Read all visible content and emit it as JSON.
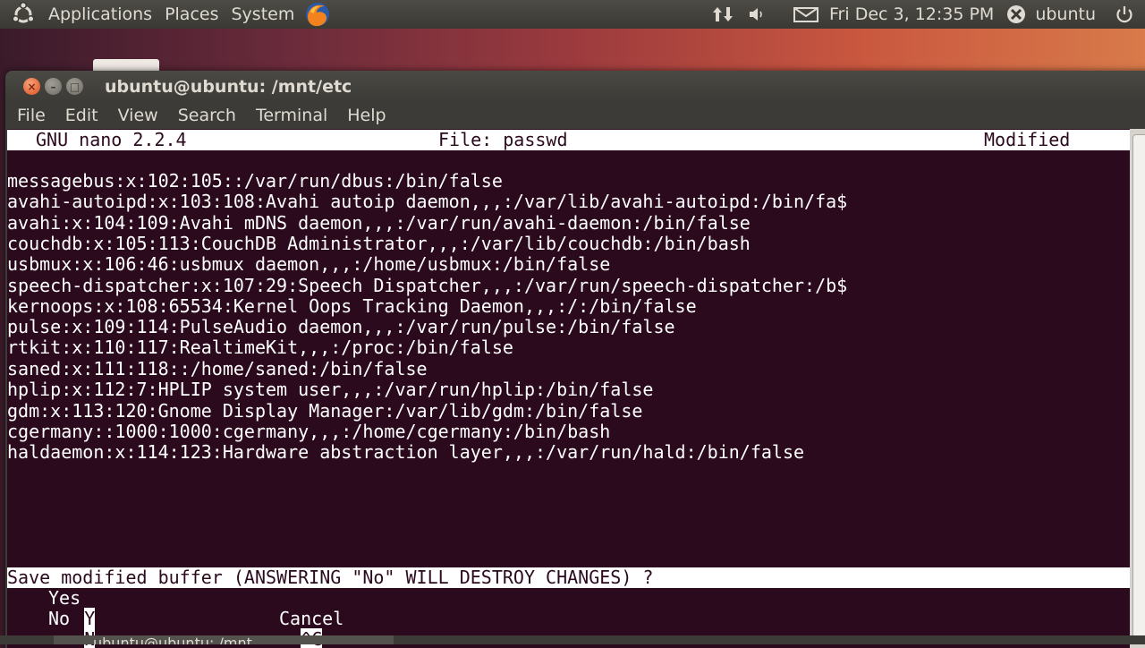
{
  "top_panel": {
    "applications": "Applications",
    "places": "Places",
    "system": "System",
    "clock": "Fri Dec 3, 12:35 PM",
    "user": "ubuntu"
  },
  "window": {
    "title": "ubuntu@ubuntu: /mnt/etc",
    "menu": [
      "File",
      "Edit",
      "View",
      "Search",
      "Terminal",
      "Help"
    ]
  },
  "nano": {
    "version": "GNU nano 2.2.4",
    "file": "File: passwd",
    "status": "Modified",
    "lines": [
      "messagebus:x:102:105::/var/run/dbus:/bin/false",
      "avahi-autoipd:x:103:108:Avahi autoip daemon,,,:/var/lib/avahi-autoipd:/bin/fa$",
      "avahi:x:104:109:Avahi mDNS daemon,,,:/var/run/avahi-daemon:/bin/false",
      "couchdb:x:105:113:CouchDB Administrator,,,:/var/lib/couchdb:/bin/bash",
      "usbmux:x:106:46:usbmux daemon,,,:/home/usbmux:/bin/false",
      "speech-dispatcher:x:107:29:Speech Dispatcher,,,:/var/run/speech-dispatcher:/b$",
      "kernoops:x:108:65534:Kernel Oops Tracking Daemon,,,:/:/bin/false",
      "pulse:x:109:114:PulseAudio daemon,,,:/var/run/pulse:/bin/false",
      "rtkit:x:110:117:RealtimeKit,,,:/proc:/bin/false",
      "saned:x:111:118::/home/saned:/bin/false",
      "hplip:x:112:7:HPLIP system user,,,:/var/run/hplip:/bin/false",
      "gdm:x:113:120:Gnome Display Manager:/var/lib/gdm:/bin/false",
      "cgermany::1000:1000:cgermany,,,:/home/cgermany:/bin/bash",
      "haldaemon:x:114:123:Hardware abstraction layer,,,:/var/run/hald:/bin/false"
    ],
    "prompt": "Save modified buffer (ANSWERING \"No\" WILL DESTROY CHANGES) ?",
    "options": {
      "yes_key": "Y",
      "yes_label": "Yes",
      "no_key": "N",
      "no_label": "No",
      "cancel_key": "^C",
      "cancel_label": "Cancel"
    }
  },
  "taskbar": {
    "entry": "ubuntu@ubuntu: /mnt"
  },
  "icons": {
    "apps": "ubuntu-logo-icon",
    "browser": "firefox-icon",
    "network": "network-arrows-icon",
    "volume": "speaker-icon",
    "mail": "envelope-icon",
    "user": "user-status-icon",
    "power": "power-icon"
  }
}
